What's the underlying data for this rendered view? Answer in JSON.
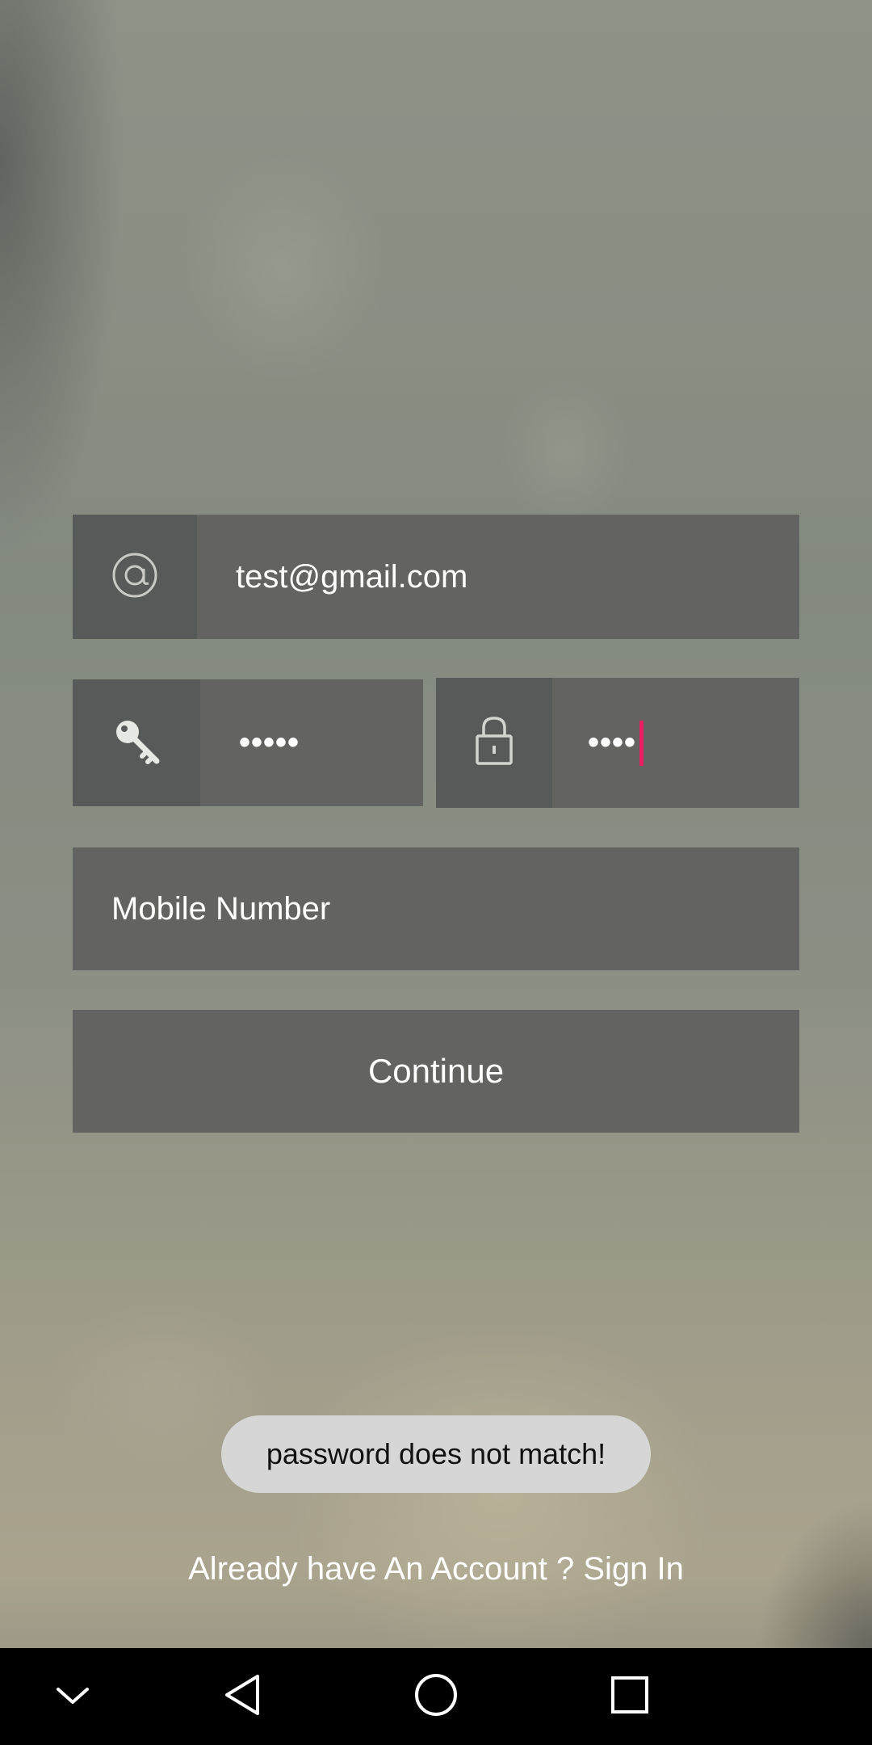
{
  "form": {
    "email_value": "test@gmail.com",
    "password_value": "•••••",
    "confirm_password_value": "••••",
    "mobile_placeholder": "Mobile Number",
    "continue_label": "Continue"
  },
  "icons": {
    "email": "at-sign-icon",
    "password": "key-icon",
    "confirm_password": "lock-icon"
  },
  "toast": {
    "message": "password does not match!"
  },
  "footer": {
    "signin_text": "Already have An Account ? Sign In"
  },
  "navbar": {
    "buttons": [
      "chevron-down-icon",
      "back-icon",
      "home-icon",
      "recents-icon"
    ]
  },
  "colors": {
    "field_bg": "#636462",
    "icon_bg": "#565a58",
    "cursor": "#e91e63",
    "toast_bg": "#d6d6d6"
  }
}
